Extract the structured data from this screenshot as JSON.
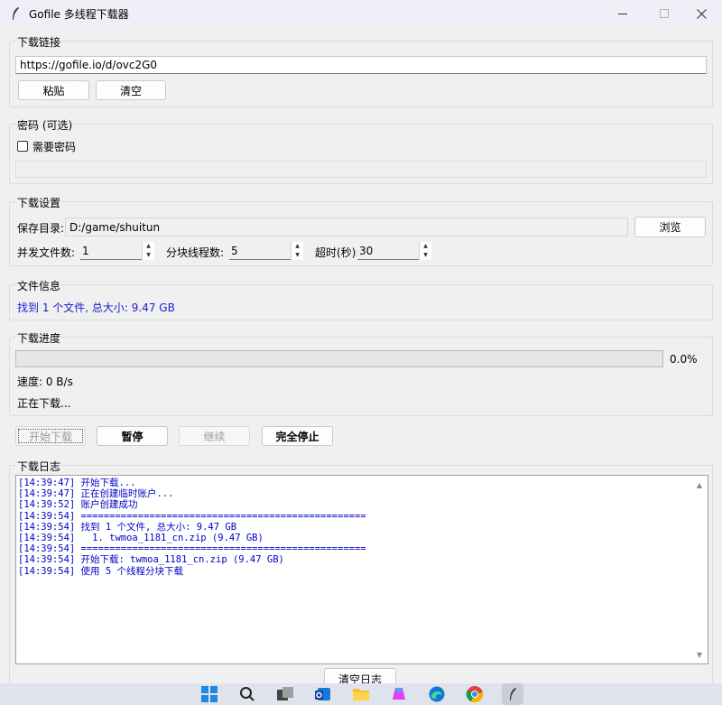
{
  "window": {
    "title": "Gofile 多线程下载器"
  },
  "link_group": {
    "label": "下载链接",
    "url_value": "https://gofile.io/d/ovc2G0",
    "paste_label": "粘贴",
    "clear_label": "清空"
  },
  "password_group": {
    "label": "密码 (可选)",
    "checkbox_label": "需要密码",
    "checked": false,
    "password_value": ""
  },
  "settings_group": {
    "label": "下载设置",
    "save_dir_label": "保存目录:",
    "save_dir_value": "D:/game/shuitun",
    "browse_label": "浏览",
    "concurrent_label": "并发文件数:",
    "concurrent_value": "1",
    "chunk_threads_label": "分块线程数:",
    "chunk_threads_value": "5",
    "timeout_label": "超时(秒):",
    "timeout_value": "30"
  },
  "info_group": {
    "label": "文件信息",
    "info_text": "找到 1 个文件, 总大小: 9.47 GB",
    "info_color": "#1a1ad6"
  },
  "progress_group": {
    "label": "下载进度",
    "progress_fraction": 0.0,
    "percent_text": "0.0%",
    "speed_text": "速度: 0 B/s",
    "status_text": "正在下载..."
  },
  "actions": {
    "start_label": "开始下载",
    "pause_label": "暂停",
    "resume_label": "继续",
    "stop_label": "完全停止"
  },
  "log_group": {
    "label": "下载日志",
    "lines": [
      "[14:39:47] 开始下载...",
      "[14:39:47] 正在创建临时账户...",
      "[14:39:52] 账户创建成功",
      "[14:39:54] ==================================================",
      "[14:39:54] 找到 1 个文件, 总大小: 9.47 GB",
      "[14:39:54]   1. twmoa_1181_cn.zip (9.47 GB)",
      "[14:39:54] ==================================================",
      "[14:39:54] 开始下载: twmoa_1181_cn.zip (9.47 GB)",
      "[14:39:54] 使用 5 个线程分块下载"
    ],
    "clear_log_label": "清空日志"
  },
  "taskbar": {
    "icons": [
      "windows-start-icon",
      "search-icon",
      "task-view-icon",
      "outlook-icon",
      "file-explorer-icon",
      "copilot-icon",
      "edge-icon",
      "chrome-icon",
      "gofile-app-icon"
    ]
  }
}
